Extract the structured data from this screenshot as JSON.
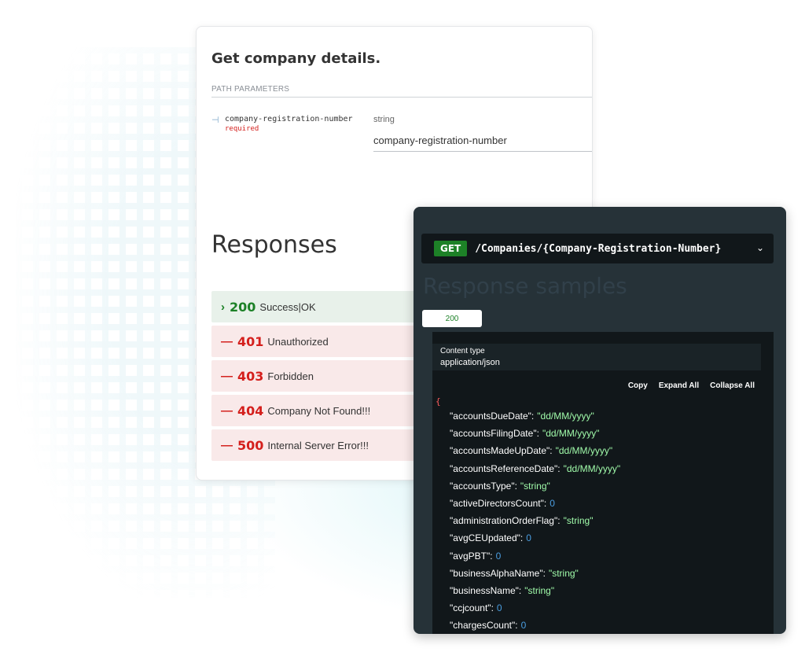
{
  "card": {
    "title": "Get company details.",
    "section_label": "PATH PARAMETERS",
    "param": {
      "name": "company-registration-number",
      "required": "required",
      "type": "string",
      "placeholder": "company-registration-number"
    },
    "responses_heading": "Responses",
    "responses": [
      {
        "icon": "›",
        "code": "200",
        "label": "Success|OK"
      },
      {
        "icon": "—",
        "code": "401",
        "label": "Unauthorized"
      },
      {
        "icon": "—",
        "code": "403",
        "label": "Forbidden"
      },
      {
        "icon": "—",
        "code": "404",
        "label": "Company Not Found!!!"
      },
      {
        "icon": "—",
        "code": "500",
        "label": "Internal Server Error!!!"
      }
    ]
  },
  "panel": {
    "method": "GET",
    "path": "/Companies/{Company-Registration-Number}",
    "samples_heading": "Response samples",
    "status_tab": "200",
    "content_type_label": "Content type",
    "content_type_value": "application/json",
    "tools": {
      "copy": "Copy",
      "expand": "Expand All",
      "collapse": "Collapse All"
    },
    "json_open": "{",
    "json": [
      {
        "key": "accountsDueDate",
        "value": "\"dd/MM/yyyy\"",
        "kind": "str"
      },
      {
        "key": "accountsFilingDate",
        "value": "\"dd/MM/yyyy\"",
        "kind": "str"
      },
      {
        "key": "accountsMadeUpDate",
        "value": "\"dd/MM/yyyy\"",
        "kind": "str"
      },
      {
        "key": "accountsReferenceDate",
        "value": "\"dd/MM/yyyy\"",
        "kind": "str"
      },
      {
        "key": "accountsType",
        "value": "\"string\"",
        "kind": "str"
      },
      {
        "key": "activeDirectorsCount",
        "value": "0",
        "kind": "num"
      },
      {
        "key": "administrationOrderFlag",
        "value": "\"string\"",
        "kind": "str"
      },
      {
        "key": "avgCEUpdated",
        "value": "0",
        "kind": "num"
      },
      {
        "key": "avgPBT",
        "value": "0",
        "kind": "num"
      },
      {
        "key": "businessAlphaName",
        "value": "\"string\"",
        "kind": "str"
      },
      {
        "key": "businessName",
        "value": "\"string\"",
        "kind": "str"
      },
      {
        "key": "ccjcount",
        "value": "0",
        "kind": "num"
      },
      {
        "key": "chargesCount",
        "value": "0",
        "kind": "num"
      }
    ]
  },
  "colors": {
    "success": "#1d8127",
    "error": "#d41f1c",
    "panel_bg": "#263238",
    "json_string": "#a0fbaa",
    "json_number": "#4a9de0"
  }
}
